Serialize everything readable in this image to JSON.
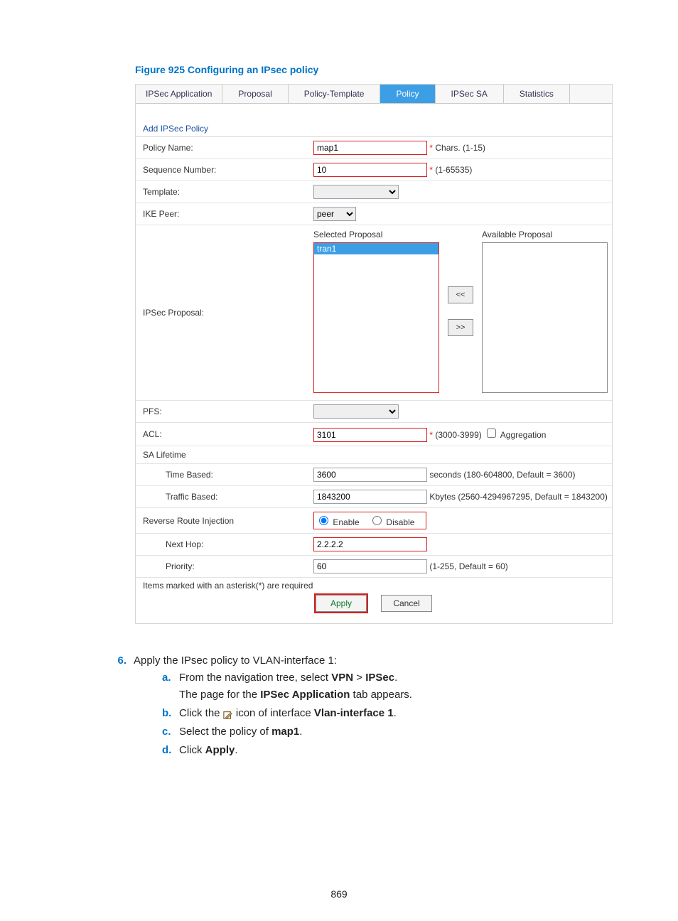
{
  "figure_caption": "Figure 925 Configuring an IPsec policy",
  "tabs": {
    "ipsec_application": "IPSec Application",
    "proposal": "Proposal",
    "policy_template": "Policy-Template",
    "policy": "Policy",
    "ipsec_sa": "IPSec SA",
    "statistics": "Statistics"
  },
  "section_title": "Add IPSec Policy",
  "form": {
    "policy_name": {
      "label": "Policy Name:",
      "value": "map1",
      "hint": "Chars. (1-15)"
    },
    "sequence_number": {
      "label": "Sequence Number:",
      "value": "10",
      "hint": "(1-65535)"
    },
    "template": {
      "label": "Template:",
      "value": ""
    },
    "ike_peer": {
      "label": "IKE Peer:",
      "value": "peer"
    },
    "ipsec_proposal": {
      "label": "IPSec Proposal:",
      "selected_header": "Selected Proposal",
      "available_header": "Available Proposal",
      "selected_items": [
        "tran1"
      ],
      "available_items": [],
      "move_left": "<<",
      "move_right": ">>"
    },
    "pfs": {
      "label": "PFS:",
      "value": ""
    },
    "acl": {
      "label": "ACL:",
      "value": "3101",
      "hint": "(3000-3999)",
      "aggregation_label": "Aggregation",
      "aggregation_checked": false
    },
    "sa_lifetime": {
      "label": "SA Lifetime"
    },
    "time_based": {
      "label": "Time Based:",
      "value": "3600",
      "hint": "seconds (180-604800, Default = 3600)"
    },
    "traffic_based": {
      "label": "Traffic Based:",
      "value": "1843200",
      "hint": "Kbytes (2560-4294967295, Default = 1843200)"
    },
    "rri": {
      "label": "Reverse Route Injection",
      "enable": "Enable",
      "disable": "Disable",
      "selected": "enable"
    },
    "next_hop": {
      "label": "Next Hop:",
      "value": "2.2.2.2"
    },
    "priority": {
      "label": "Priority:",
      "value": "60",
      "hint": "(1-255, Default = 60)"
    }
  },
  "footer_note": "Items marked with an asterisk(*) are required",
  "buttons": {
    "apply": "Apply",
    "cancel": "Cancel"
  },
  "instructions": {
    "step_number": "6.",
    "step_text_pre": "Apply the IPsec policy to VLAN-interface 1:",
    "a_label": "a.",
    "a_line1_pre": "From the navigation tree, select ",
    "a_line1_bold1": "VPN",
    "a_line1_sep": " > ",
    "a_line1_bold2": "IPSec",
    "a_line1_post": ".",
    "a_line2_pre": "The page for the ",
    "a_line2_bold": "IPSec Application",
    "a_line2_post": " tab appears.",
    "b_label": "b.",
    "b_pre": "Click the ",
    "b_mid": " icon of interface ",
    "b_bold": "Vlan-interface 1",
    "b_post": ".",
    "c_label": "c.",
    "c_pre": "Select the policy of ",
    "c_bold": "map1",
    "c_post": ".",
    "d_label": "d.",
    "d_pre": "Click ",
    "d_bold": "Apply",
    "d_post": "."
  },
  "page_number": "869"
}
